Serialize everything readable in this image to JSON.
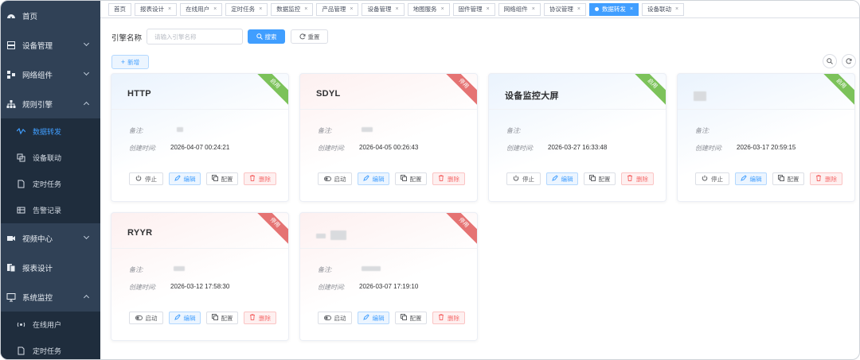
{
  "sidebar": {
    "items": [
      {
        "label": "首页"
      },
      {
        "label": "设备管理"
      },
      {
        "label": "网络组件"
      },
      {
        "label": "规则引擎"
      },
      {
        "label": "视频中心"
      },
      {
        "label": "报表设计"
      },
      {
        "label": "系统监控"
      }
    ],
    "rule_sub": [
      {
        "label": "数据转发"
      },
      {
        "label": "设备联动"
      },
      {
        "label": "定时任务"
      },
      {
        "label": "告警记录"
      }
    ],
    "monitor_sub": [
      {
        "label": "在线用户"
      },
      {
        "label": "定时任务"
      }
    ]
  },
  "tabs": [
    {
      "label": "首页"
    },
    {
      "label": "报表设计"
    },
    {
      "label": "在线用户"
    },
    {
      "label": "定时任务"
    },
    {
      "label": "数据监控"
    },
    {
      "label": "产品管理"
    },
    {
      "label": "设备管理"
    },
    {
      "label": "地图服务"
    },
    {
      "label": "固件管理"
    },
    {
      "label": "网络组件"
    },
    {
      "label": "协议管理"
    },
    {
      "label": "数据转发"
    },
    {
      "label": "设备联动"
    }
  ],
  "search": {
    "label": "引擎名称",
    "placeholder": "请输入引擎名称",
    "search_btn": "搜索",
    "reset_btn": "重置",
    "add_btn": "新增"
  },
  "card_labels": {
    "remark": "备注:",
    "created": "创建时间:",
    "edit": "编辑",
    "config": "配置",
    "delete": "删除"
  },
  "cards": [
    {
      "title": "HTTP",
      "status": "启用",
      "toggle": "停止",
      "created": "2026-04-07 00:24:21"
    },
    {
      "title": "SDYL",
      "status": "停用",
      "toggle": "启动",
      "created": "2026-04-05 00:26:43"
    },
    {
      "title": "设备监控大屏",
      "status": "启用",
      "toggle": "停止",
      "created": "2026-03-27 16:33:48"
    },
    {
      "title": "",
      "status": "启用",
      "toggle": "停止",
      "created": "2026-03-17 20:59:15"
    },
    {
      "title": "RYYR",
      "status": "停用",
      "toggle": "启动",
      "created": "2026-03-12 17:58:30"
    },
    {
      "title": "",
      "status": "停用",
      "toggle": "启动",
      "created": "2026-03-07 17:19:10"
    }
  ],
  "colors": {
    "sidebar_bg": "#304156",
    "submenu_bg": "#1f2d3d",
    "primary": "#409eff",
    "enabled_ribbon": "#7cc25a",
    "stopped_ribbon": "#e57373",
    "danger": "#f56c6c"
  }
}
